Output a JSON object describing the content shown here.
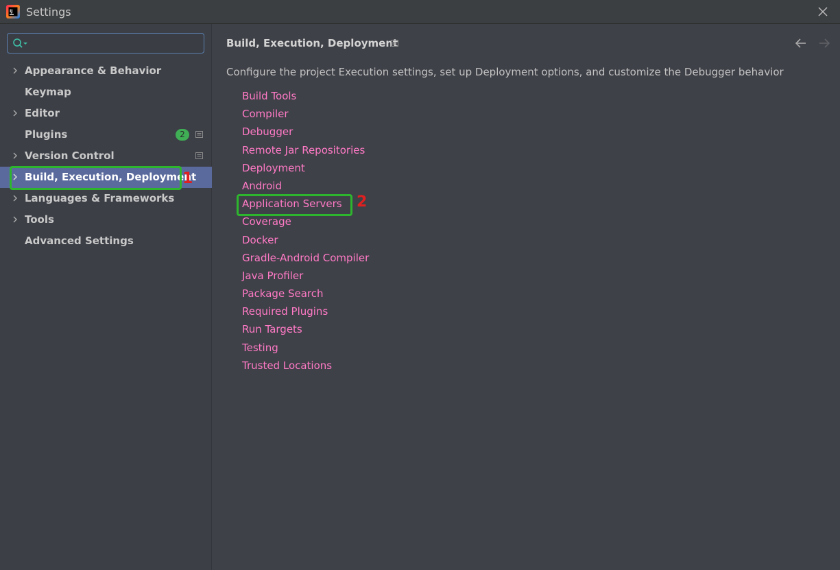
{
  "window": {
    "title": "Settings",
    "logo_text": "IJ",
    "logo_icon": "intellij-logo-icon",
    "close_icon": "close-icon"
  },
  "search": {
    "value": "",
    "placeholder": "",
    "icon": "search-icon"
  },
  "sidebar": {
    "items": [
      {
        "label": "Appearance & Behavior",
        "expandable": true
      },
      {
        "label": "Keymap",
        "expandable": false
      },
      {
        "label": "Editor",
        "expandable": true
      },
      {
        "label": "Plugins",
        "expandable": false,
        "badge": "2",
        "project_icon": true
      },
      {
        "label": "Version Control",
        "expandable": true,
        "project_icon": true
      },
      {
        "label": "Build, Execution, Deployment",
        "expandable": true,
        "selected": true
      },
      {
        "label": "Languages & Frameworks",
        "expandable": true
      },
      {
        "label": "Tools",
        "expandable": true
      },
      {
        "label": "Advanced Settings",
        "expandable": false
      }
    ]
  },
  "main": {
    "title": "Build, Execution, Deployment",
    "description": "Configure the project Execution settings, set up Deployment options, and customize the Debugger behavior",
    "links": [
      "Build Tools",
      "Compiler",
      "Debugger",
      "Remote Jar Repositories",
      "Deployment",
      "Android",
      "Application Servers",
      "Coverage",
      "Docker",
      "Gradle-Android Compiler",
      "Java Profiler",
      "Package Search",
      "Required Plugins",
      "Run Targets",
      "Testing",
      "Trusted Locations"
    ]
  },
  "annotations": {
    "step1": "1",
    "step2": "2"
  },
  "colors": {
    "link": "#ff7ac6",
    "selected": "#5b6a9c",
    "badge": "#3fae55",
    "highlight": "#2eb52e",
    "annotation_number": "#e02020"
  }
}
